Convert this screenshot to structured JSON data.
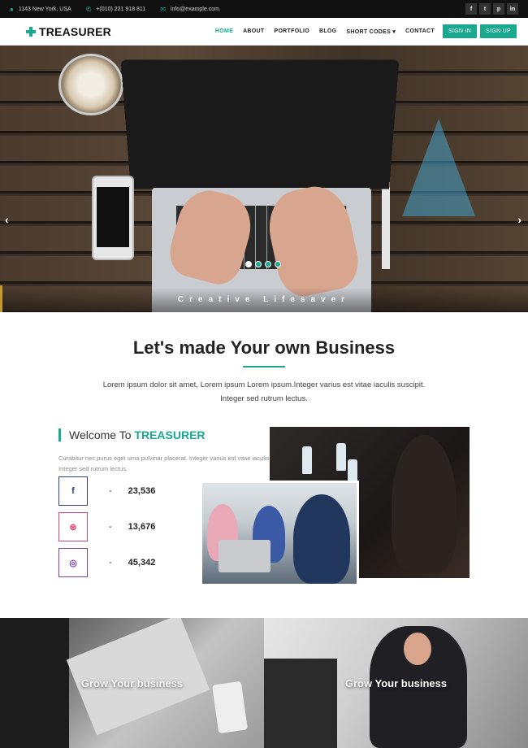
{
  "topbar": {
    "address": "1143 New York, USA",
    "phone": "+(010) 221 918 811",
    "email": "info@example.com",
    "social": [
      "f",
      "t",
      "p",
      "in"
    ]
  },
  "nav": {
    "logo": "TREASURER",
    "items": [
      "HOME",
      "ABOUT",
      "PORTFOLIO",
      "BLOG",
      "SHORT CODES ▾",
      "CONTACT"
    ],
    "active_index": 0,
    "sign_in": "SIGN IN",
    "sign_up": "SIGN UP"
  },
  "hero": {
    "caption": "Creative Lifesaver",
    "prev": "‹",
    "next": "›",
    "slides": 4,
    "active_slide": 0
  },
  "intro": {
    "title": "Let's made Your own Business",
    "text": "Lorem ipsum dolor sit amet, Lorem ipsum Lorem ipsum.Integer varius est vitae iaculis suscipit. Integer sed rutrum lectus."
  },
  "welcome": {
    "title_prefix": "Welcome To ",
    "title_brand": "TREASURER",
    "text": "Curabitur nec purus eget urna pulvinar placerat. Integer varius est vitae iaculis suscipit. Integer sed rutrum lectus.",
    "stats": [
      {
        "icon": "facebook-icon",
        "glyph": "f",
        "color": "#2d3e8f",
        "value": "23,536"
      },
      {
        "icon": "dribbble-icon",
        "glyph": "⊛",
        "color": "#d94a73",
        "value": "13,676"
      },
      {
        "icon": "instagram-icon",
        "glyph": "◎",
        "color": "#7b3fb0",
        "value": "45,342"
      }
    ]
  },
  "cards": [
    {
      "label": "Grow Your business"
    },
    {
      "label": "Grow Your business"
    }
  ],
  "colors": {
    "accent": "#19a98f"
  }
}
